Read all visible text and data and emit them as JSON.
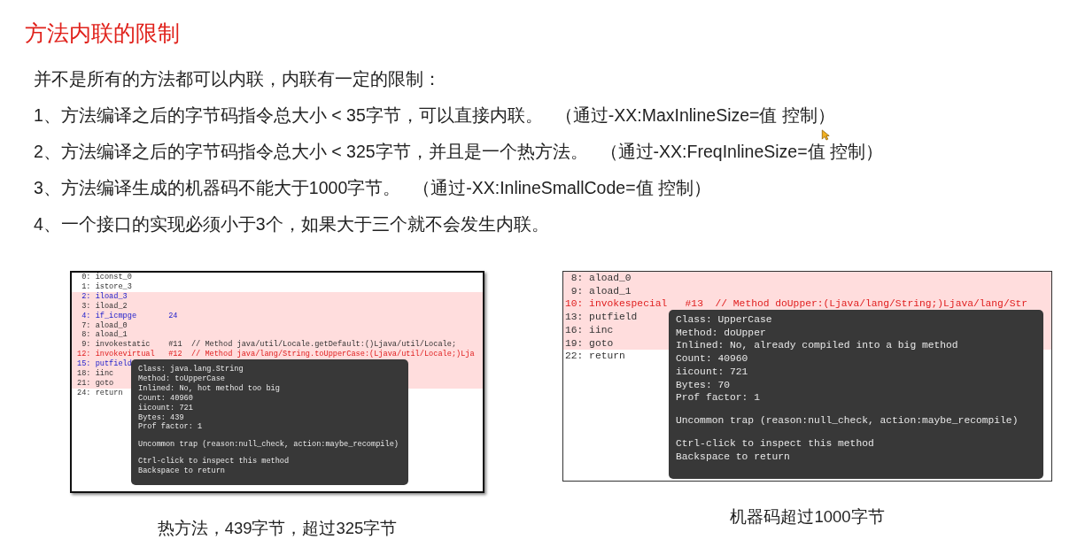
{
  "title": "方法内联的限制",
  "intro": "并不是所有的方法都可以内联，内联有一定的限制：",
  "rules": [
    {
      "text": "1、方法编译之后的字节码指令总大小 < 35字节，可以直接内联。",
      "note": "（通过-XX:MaxInlineSize=值 控制）"
    },
    {
      "text": "2、方法编译之后的字节码指令总大小 < 325字节，并且是一个热方法。",
      "note": "（通过-XX:FreqInlineSize=值 控制）"
    },
    {
      "text": "3、方法编译生成的机器码不能大于1000字节。",
      "note": "（通过-XX:InlineSmallCode=值 控制）"
    },
    {
      "text": "4、一个接口的实现必须小于3个，如果大于三个就不会发生内联。"
    }
  ],
  "figures": [
    {
      "code_lines": [
        {
          "text": " 0: iconst_0",
          "kind": "plain",
          "highlighted": false
        },
        {
          "text": " 1: istore_3",
          "kind": "plain",
          "highlighted": false
        },
        {
          "text": " 2: iload_3",
          "kind": "branch",
          "highlighted": true
        },
        {
          "text": " 3: iload_2",
          "kind": "plain",
          "highlighted": true
        },
        {
          "text": " 4: if_icmpge       24",
          "kind": "branch",
          "highlighted": true
        },
        {
          "text": " 7: aload_0",
          "kind": "plain",
          "highlighted": true
        },
        {
          "text": " 8: aload_1",
          "kind": "plain",
          "highlighted": true
        },
        {
          "text": " 9: invokestatic    #11  // Method java/util/Locale.getDefault:()Ljava/util/Locale;",
          "kind": "plain",
          "highlighted": true
        },
        {
          "text": "12: invokevirtual   #12  // Method java/lang/String.toUpperCase:(Ljava/util/Locale;)Lja",
          "kind": "call",
          "highlighted": true
        },
        {
          "text": "15: putfield",
          "kind": "branch",
          "highlighted": true
        },
        {
          "text": "18: iinc",
          "kind": "plain",
          "highlighted": true
        },
        {
          "text": "21: goto",
          "kind": "plain",
          "highlighted": true
        },
        {
          "text": "24: return",
          "kind": "plain",
          "highlighted": false
        }
      ],
      "tooltip": [
        [
          "Class: java.lang.String",
          "Method: toUpperCase",
          "Inlined: No, hot method too big",
          "Count: 40960",
          "iicount: 721",
          "Bytes: 439",
          "Prof factor: 1"
        ],
        [
          "Uncommon trap (reason:null_check, action:maybe_recompile)"
        ],
        [
          "Ctrl-click to inspect this method",
          "Backspace to return"
        ]
      ],
      "caption": "热方法，439字节，超过325字节"
    },
    {
      "code_lines": [
        {
          "text": " 8: aload_0",
          "kind": "plain",
          "highlighted": true
        },
        {
          "text": " 9: aload_1",
          "kind": "plain",
          "highlighted": true
        },
        {
          "text": "10: invokespecial   #13  // Method doUpper:(Ljava/lang/String;)Ljava/lang/Str",
          "kind": "call",
          "highlighted": true
        },
        {
          "text": "13: putfield",
          "kind": "plain",
          "highlighted": true
        },
        {
          "text": "16: iinc",
          "kind": "plain",
          "highlighted": true
        },
        {
          "text": "19: goto",
          "kind": "plain",
          "highlighted": true
        },
        {
          "text": "22: return",
          "kind": "plain",
          "highlighted": false
        }
      ],
      "tooltip": [
        [
          "Class: UpperCase",
          "Method: doUpper",
          "Inlined: No, already compiled into a big method",
          "Count: 40960",
          "iicount: 721",
          "Bytes: 70",
          "Prof factor: 1"
        ],
        [
          "Uncommon trap (reason:null_check, action:maybe_recompile)"
        ],
        [
          "Ctrl-click to inspect this method",
          "Backspace to return"
        ]
      ],
      "caption": "机器码超过1000字节"
    }
  ]
}
